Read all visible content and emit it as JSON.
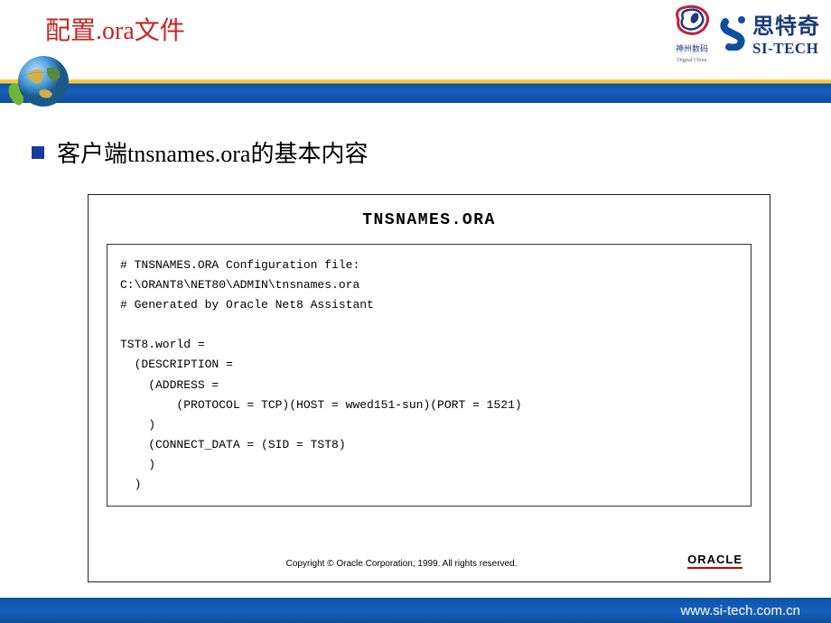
{
  "header": {
    "title": "配置.ora文件",
    "logo_dc_sub": "神州数码",
    "logo_dc_sub_en": "Digital China",
    "logo_sitech_cn": "思特奇",
    "logo_sitech_en": "SI-TECH"
  },
  "content": {
    "bullet": "客户端tnsnames.ora的基本内容",
    "doc_title": "TNSNAMES.ORA",
    "doc_body": "# TNSNAMES.ORA Configuration file:\nC:\\ORANT8\\NET80\\ADMIN\\tnsnames.ora\n# Generated by Oracle Net8 Assistant\n\nTST8.world =\n  (DESCRIPTION =\n    (ADDRESS =\n        (PROTOCOL = TCP)(HOST = wwed151-sun)(PORT = 1521)\n    )\n    (CONNECT_DATA = (SID = TST8)\n    )\n  )",
    "copyright": "Copyright © Oracle Corporation, 1999. All rights reserved.",
    "oracle": "ORACLE"
  },
  "footer": {
    "url": "www.si-tech.com.cn"
  }
}
